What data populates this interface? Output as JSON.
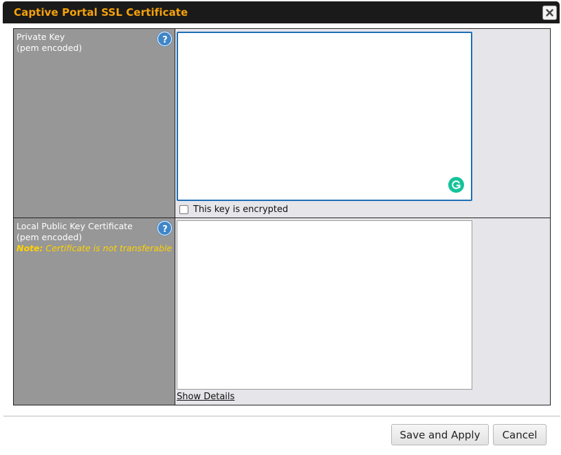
{
  "dialog": {
    "title": "Captive Portal SSL Certificate"
  },
  "private_key": {
    "label_line1": "Private Key",
    "label_line2": "(pem encoded)",
    "value": "",
    "encrypted_checkbox_label": "This key is encrypted",
    "encrypted_checked": false
  },
  "public_cert": {
    "label_line1": "Local Public Key Certificate",
    "label_line2": "(pem encoded)",
    "note_prefix": "Note:",
    "note_text": "Certificate is not transferable",
    "value": "",
    "show_details_label": "Show Details"
  },
  "footer": {
    "save_label": "Save and Apply",
    "cancel_label": "Cancel"
  },
  "icons": {
    "close": "close-icon",
    "help": "help-icon",
    "grammarly": "grammarly-icon"
  },
  "colors": {
    "title": "#f5a20a",
    "label_bg": "#979797",
    "note": "#ffd200",
    "focus_border": "#1c6fb5",
    "help": "#3f86c8"
  }
}
